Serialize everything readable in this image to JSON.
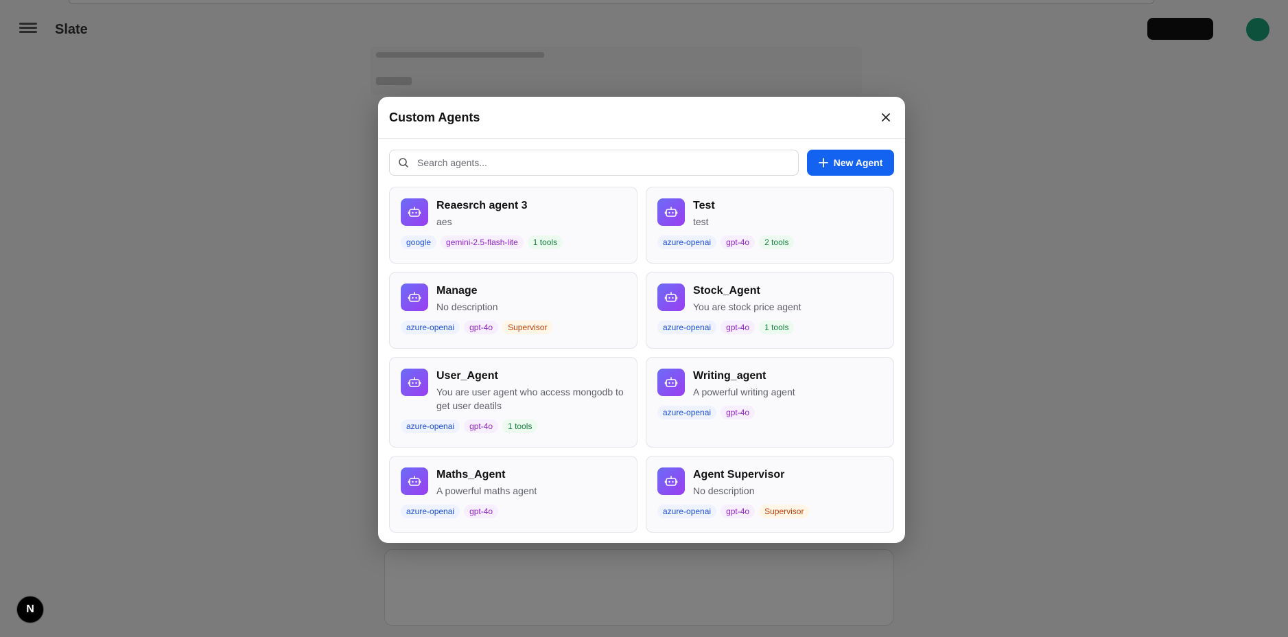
{
  "background": {
    "app_title": "Slate",
    "badge_letter": "N"
  },
  "modal": {
    "title": "Custom Agents",
    "search_placeholder": "Search agents...",
    "new_agent_label": "New Agent",
    "agents": [
      {
        "name": "Reaesrch agent 3",
        "description": "aes",
        "tags": [
          {
            "text": "google",
            "kind": "provider"
          },
          {
            "text": "gemini-2.5-flash-lite",
            "kind": "model"
          },
          {
            "text": "1 tools",
            "kind": "tools"
          }
        ]
      },
      {
        "name": "Test",
        "description": "test",
        "tags": [
          {
            "text": "azure-openai",
            "kind": "provider"
          },
          {
            "text": "gpt-4o",
            "kind": "model"
          },
          {
            "text": "2 tools",
            "kind": "tools"
          }
        ]
      },
      {
        "name": "Manage",
        "description": "No description",
        "tags": [
          {
            "text": "azure-openai",
            "kind": "provider"
          },
          {
            "text": "gpt-4o",
            "kind": "model"
          },
          {
            "text": "Supervisor",
            "kind": "role"
          }
        ]
      },
      {
        "name": "Stock_Agent",
        "description": "You are stock price agent",
        "tags": [
          {
            "text": "azure-openai",
            "kind": "provider"
          },
          {
            "text": "gpt-4o",
            "kind": "model"
          },
          {
            "text": "1 tools",
            "kind": "tools"
          }
        ]
      },
      {
        "name": "User_Agent",
        "description": "You are user agent who access mongodb to get user deatils",
        "tags": [
          {
            "text": "azure-openai",
            "kind": "provider"
          },
          {
            "text": "gpt-4o",
            "kind": "model"
          },
          {
            "text": "1 tools",
            "kind": "tools"
          }
        ]
      },
      {
        "name": "Writing_agent",
        "description": "A powerful writing agent",
        "tags": [
          {
            "text": "azure-openai",
            "kind": "provider"
          },
          {
            "text": "gpt-4o",
            "kind": "model"
          }
        ]
      },
      {
        "name": "Maths_Agent",
        "description": "A powerful maths agent",
        "tags": [
          {
            "text": "azure-openai",
            "kind": "provider"
          },
          {
            "text": "gpt-4o",
            "kind": "model"
          }
        ]
      },
      {
        "name": "Agent Supervisor",
        "description": "No description",
        "tags": [
          {
            "text": "azure-openai",
            "kind": "provider"
          },
          {
            "text": "gpt-4o",
            "kind": "model"
          },
          {
            "text": "Supervisor",
            "kind": "role"
          }
        ]
      }
    ]
  },
  "colors": {
    "accent": "#1462f0",
    "provider_tag": "#1d4ed8",
    "model_tag": "#9326c8",
    "tools_tag": "#15803d",
    "role_tag": "#c2410c"
  }
}
